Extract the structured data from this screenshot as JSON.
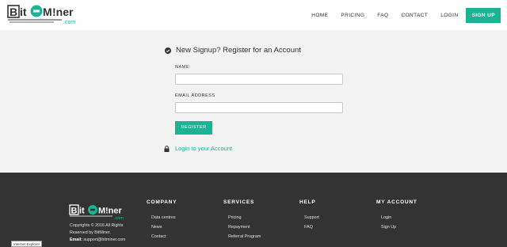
{
  "brand": {
    "logo_text": "BitMiner",
    "logo_parts": [
      "B",
      "it",
      "M",
      "!ner"
    ],
    "logo_sub": ".com",
    "accent": "#1ab394",
    "dark": "#333333"
  },
  "nav": {
    "items": [
      "HOME",
      "PRICING",
      "FAQ",
      "CONTACT",
      "LOGIN"
    ],
    "signup": "SIGN UP"
  },
  "form": {
    "title": "New Signup? Register for an Account",
    "name_label": "NAME:",
    "name_value": "",
    "email_label": "EMAIL ADDRESS",
    "email_value": "",
    "register": "REGISTER",
    "login_link": "Login to your Account"
  },
  "footer": {
    "copyright_line1": "Copyrights © 2016 All Rights",
    "copyright_line2": "Reserved by BitMiner.",
    "email_label": "Email:",
    "email_value": "support@bitminer.com",
    "columns": [
      {
        "title": "COMPANY",
        "links": [
          "Data centres",
          "News",
          "Contact"
        ]
      },
      {
        "title": "SERVICES",
        "links": [
          "Pricing",
          "Repayment",
          "Referral Program"
        ]
      },
      {
        "title": "HELP",
        "links": [
          "Support",
          "FAQ"
        ]
      },
      {
        "title": "MY ACCOUNT",
        "links": [
          "Login",
          "Sign Up"
        ]
      }
    ]
  },
  "browser_badge": "Internet Explorer"
}
